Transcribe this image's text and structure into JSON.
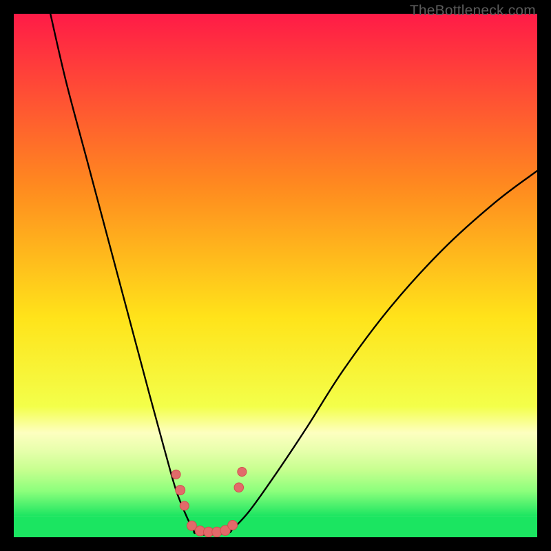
{
  "watermark": "TheBottleneck.com",
  "colors": {
    "frame": "#000000",
    "curve": "#000000",
    "band_green": "#1be561",
    "band_pale": "#e5ffb2",
    "marker_fill": "#e26a6a",
    "marker_stroke": "#d24e4e",
    "grad_top": "#ff1b47",
    "grad_mid1": "#ff8a1f",
    "grad_mid2": "#ffe31a",
    "grad_mid3": "#f3ff4a",
    "grad_band_top": "#fdffbf"
  },
  "chart_data": {
    "type": "line",
    "title": "",
    "xlabel": "",
    "ylabel": "",
    "xlim": [
      0,
      100
    ],
    "ylim": [
      0,
      100
    ],
    "series": [
      {
        "name": "left-branch",
        "x": [
          7,
          10,
          14,
          18,
          22,
          26,
          29,
          31,
          33,
          34.5
        ],
        "values": [
          100,
          87,
          72,
          57,
          42,
          27,
          16,
          9,
          4,
          1
        ]
      },
      {
        "name": "valley",
        "x": [
          34.5,
          36,
          38,
          40,
          41.5
        ],
        "values": [
          1,
          0.5,
          0.5,
          0.7,
          1.2
        ]
      },
      {
        "name": "right-branch",
        "x": [
          41.5,
          45,
          50,
          56,
          63,
          72,
          82,
          92,
          100
        ],
        "values": [
          1.2,
          5,
          12,
          21,
          32,
          44,
          55,
          64,
          70
        ]
      }
    ],
    "threshold_bands": [
      {
        "name": "green-zone",
        "y_from": 0,
        "y_to": 4
      },
      {
        "name": "transition",
        "y_from": 4,
        "y_to": 20
      }
    ],
    "markers": [
      {
        "x": 31.0,
        "y": 12.0,
        "r": 1.4
      },
      {
        "x": 31.8,
        "y": 9.0,
        "r": 1.6
      },
      {
        "x": 32.6,
        "y": 6.0,
        "r": 1.4
      },
      {
        "x": 34.0,
        "y": 2.2,
        "r": 1.6
      },
      {
        "x": 35.6,
        "y": 1.2,
        "r": 1.7
      },
      {
        "x": 37.2,
        "y": 1.0,
        "r": 1.7
      },
      {
        "x": 38.8,
        "y": 1.0,
        "r": 1.7
      },
      {
        "x": 40.4,
        "y": 1.3,
        "r": 1.7
      },
      {
        "x": 41.8,
        "y": 2.3,
        "r": 1.6
      },
      {
        "x": 43.0,
        "y": 9.5,
        "r": 1.5
      },
      {
        "x": 43.6,
        "y": 12.5,
        "r": 1.4
      }
    ]
  }
}
